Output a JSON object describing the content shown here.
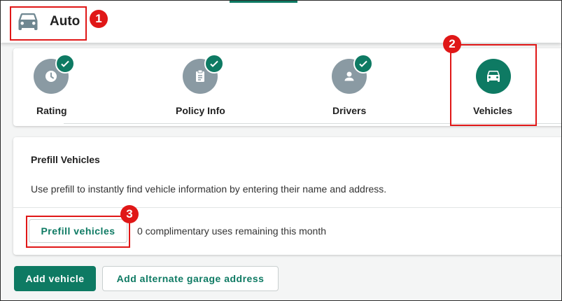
{
  "header": {
    "title": "Auto",
    "logo_icon": "car-icon"
  },
  "steps": [
    {
      "label": "Rating",
      "icon": "clock-icon",
      "completed": true,
      "active": false
    },
    {
      "label": "Policy Info",
      "icon": "clipboard-icon",
      "completed": true,
      "active": false
    },
    {
      "label": "Drivers",
      "icon": "person-icon",
      "completed": true,
      "active": false
    },
    {
      "label": "Vehicles",
      "icon": "car-icon",
      "completed": false,
      "active": true
    }
  ],
  "prefill": {
    "title": "Prefill Vehicles",
    "description": "Use prefill to instantly find vehicle information by entering their name and address.",
    "button_label": "Prefill vehicles",
    "uses_text": "0 complimentary uses remaining this month"
  },
  "actions": {
    "add_vehicle_label": "Add vehicle",
    "add_garage_label": "Add alternate garage address"
  },
  "annotations": [
    "1",
    "2",
    "3"
  ],
  "colors": {
    "accent": "#0e7a63",
    "step_inactive": "#8a9aa3",
    "annotation": "#e01717"
  }
}
